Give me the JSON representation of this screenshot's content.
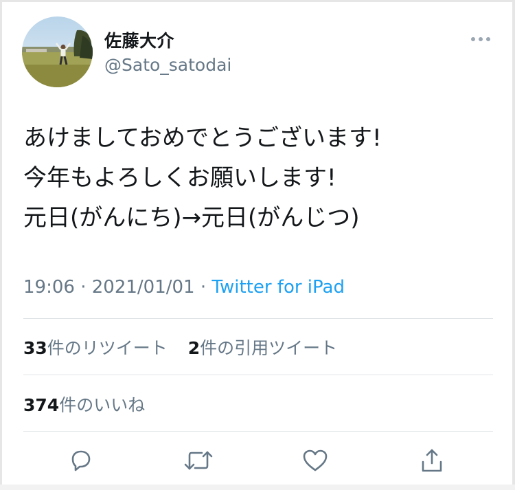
{
  "user": {
    "display_name": "佐藤大介",
    "handle": "@Sato_satodai",
    "avatar_icon": "user-avatar-photo"
  },
  "tweet": {
    "lines": [
      "あけましておめでとうございます!",
      "今年もよろしくお願いします!",
      "元日(がんにち)→元日(がんじつ)"
    ],
    "time": "19:06",
    "date": "2021/01/01",
    "separator": " · ",
    "source": "Twitter for iPad"
  },
  "stats": {
    "retweets_count": "33",
    "retweets_label": "件のリツイート",
    "quotes_count": "2",
    "quotes_label": "件の引用ツイート",
    "likes_count": "374",
    "likes_label": "件のいいね"
  },
  "icons": {
    "more": "more-icon",
    "reply": "reply-icon",
    "retweet": "retweet-icon",
    "like": "like-icon",
    "share": "share-icon"
  },
  "colors": {
    "accent": "#1da1f2",
    "secondary_text": "#657786",
    "primary_text": "#14171a",
    "icon": "#657786"
  }
}
